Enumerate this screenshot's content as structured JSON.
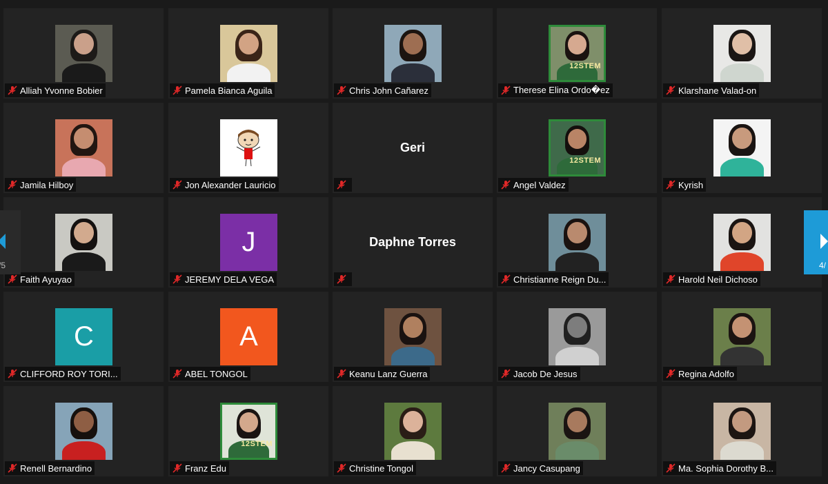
{
  "participants": [
    {
      "name": "Alliah Yvonne Bobier",
      "kind": "photo",
      "bg": "#5b5b52",
      "skin": "#caa08a",
      "hair": "#1d1a18",
      "shirt": "#1a1a1a"
    },
    {
      "name": "Pamela Bianca Aguila",
      "kind": "photo",
      "bg": "#d9c79a",
      "skin": "#d2a384",
      "hair": "#3a2418",
      "shirt": "#f2f2f2"
    },
    {
      "name": "Chris John Cañarez",
      "kind": "photo",
      "bg": "#8fa8b8",
      "skin": "#9e6e52",
      "hair": "#1c1410",
      "shirt": "#2b2f3a"
    },
    {
      "name": "Therese Elina Ordo�ez",
      "kind": "photo",
      "framed": true,
      "bg": "#7f8f6a",
      "skin": "#d6a990",
      "hair": "#1a1210",
      "shirt": "#2e6a3a",
      "tag": "12STEM"
    },
    {
      "name": "Klarshane Valad-on",
      "kind": "photo",
      "bg": "#e8e8e6",
      "skin": "#e0bfa7",
      "hair": "#1b1614",
      "shirt": "#cfd6cf"
    },
    {
      "name": "Jamila Hilboy",
      "kind": "photo",
      "bg": "#c8735a",
      "skin": "#c58d70",
      "hair": "#221611",
      "shirt": "#e8a8b0"
    },
    {
      "name": "Jon Alexander Lauricio",
      "kind": "cartoon",
      "bg": "#ffffff"
    },
    {
      "name": "",
      "kind": "nameonly",
      "display": "Geri"
    },
    {
      "name": "Angel Valdez",
      "kind": "photo",
      "framed": true,
      "bg": "#3f6a4a",
      "skin": "#b98466",
      "hair": "#140f0d",
      "shirt": "#2e6a3a",
      "tag": "12STEM"
    },
    {
      "name": "Kyrish",
      "kind": "photo",
      "bg": "#f4f4f4",
      "skin": "#c89a7d",
      "hair": "#1a1412",
      "shirt": "#2fb39a"
    },
    {
      "name": "Faith Ayuyao",
      "kind": "photo",
      "bg": "#c9c9c3",
      "skin": "#d2aa8e",
      "hair": "#141110",
      "shirt": "#1a1a1a"
    },
    {
      "name": "JEREMY DELA VEGA",
      "kind": "initial",
      "letter": "J",
      "bg": "#7b2fa6"
    },
    {
      "name": "",
      "kind": "nameonly",
      "display": "Daphne Torres"
    },
    {
      "name": "Christianne Reign Du...",
      "kind": "photo",
      "bg": "#6f8e9a",
      "skin": "#b98a6e",
      "hair": "#1a1210",
      "shirt": "#222222"
    },
    {
      "name": "Harold Neil Dichoso",
      "kind": "photo",
      "bg": "#e2e2e0",
      "skin": "#d2a584",
      "hair": "#1a1412",
      "shirt": "#e0452a"
    },
    {
      "name": "CLIFFORD ROY TORI...",
      "kind": "initial",
      "letter": "C",
      "bg": "#1a9ea6"
    },
    {
      "name": "ABEL TONGOL",
      "kind": "initial",
      "letter": "A",
      "bg": "#f2571e"
    },
    {
      "name": "Keanu Lanz Guerra",
      "kind": "photo",
      "bg": "#6e5240",
      "skin": "#b0805f",
      "hair": "#1a1210",
      "shirt": "#3c6a8a"
    },
    {
      "name": "Jacob De Jesus",
      "kind": "photo",
      "bg": "#9a9a9a",
      "skin": "#7d7d7d",
      "hair": "#202020",
      "shirt": "#d0d0d0"
    },
    {
      "name": "Regina Adolfo",
      "kind": "photo",
      "bg": "#6b7f4a",
      "skin": "#c49273",
      "hair": "#1b1411",
      "shirt": "#333333"
    },
    {
      "name": "Renell Bernardino",
      "kind": "photo",
      "bg": "#86a4b8",
      "skin": "#8e5e44",
      "hair": "#16100d",
      "shirt": "#c82020"
    },
    {
      "name": "Franz Edu",
      "kind": "photo",
      "framed": true,
      "bg": "#dfe4d8",
      "skin": "#d3a88c",
      "hair": "#1a1412",
      "shirt": "#2e6a3a",
      "tag": "12STEM"
    },
    {
      "name": "Christine Tongol",
      "kind": "photo",
      "bg": "#5d7a3e",
      "skin": "#dcb29a",
      "hair": "#2a1d16",
      "shirt": "#e8e0d0"
    },
    {
      "name": "Jancy Casupang",
      "kind": "photo",
      "bg": "#6f7f5a",
      "skin": "#a87a5e",
      "hair": "#1a1412",
      "shirt": "#6a8c6a"
    },
    {
      "name": "Ma. Sophia Dorothy B...",
      "kind": "photo",
      "bg": "#c8b6a4",
      "skin": "#c39a80",
      "hair": "#1c1512",
      "shirt": "#dcdad0"
    }
  ],
  "nav": {
    "prev_page": "/5",
    "next_page": "4/"
  },
  "colors": {
    "mute_icon": "#e02828",
    "tile_bg": "#232323",
    "next_button": "#1e9bd7"
  }
}
